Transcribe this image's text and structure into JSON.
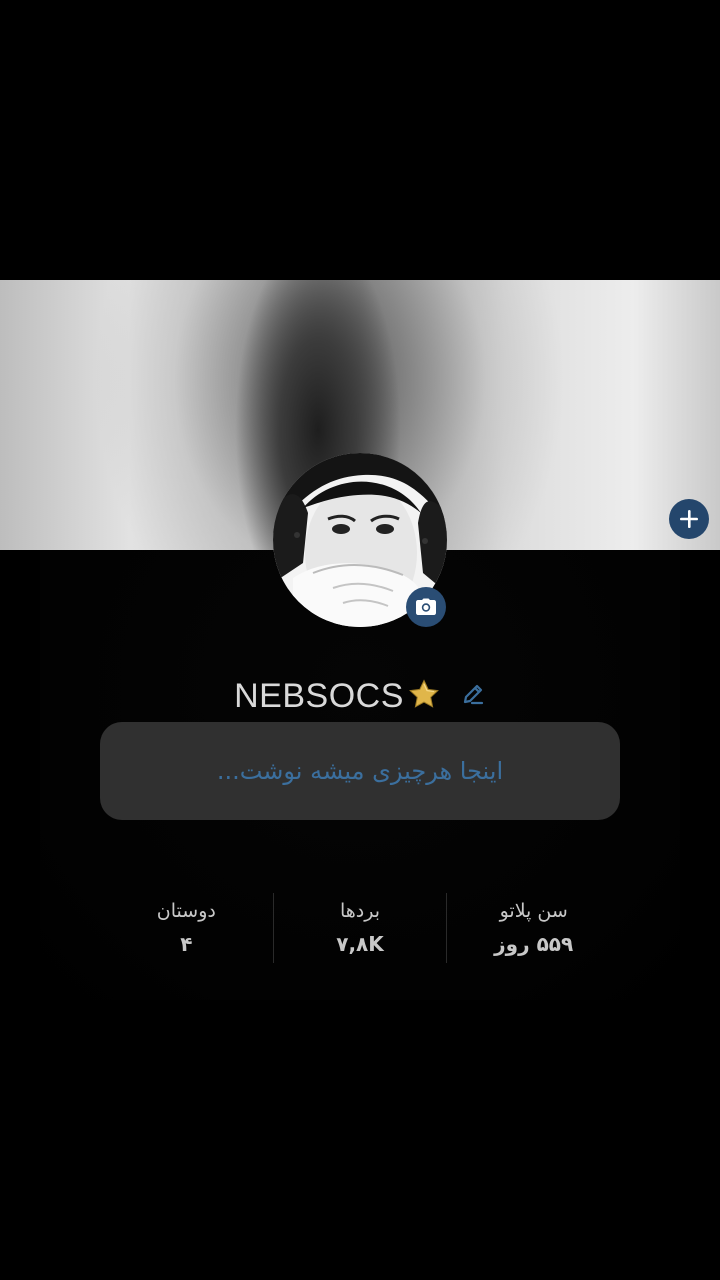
{
  "profile": {
    "username": "NEBSOCS",
    "bio_placeholder": "اینجا هرچیزی میشه نوشت..."
  },
  "stats": [
    {
      "label": "سن پلاتو",
      "value": "۵۵۹ روز"
    },
    {
      "label": "بردها",
      "value": "۷,۸K"
    },
    {
      "label": "دوستان",
      "value": "۴"
    }
  ],
  "icons": {
    "add": "plus-icon",
    "camera": "camera-icon",
    "star": "star-icon",
    "edit": "pencil-icon"
  },
  "colors": {
    "accent": "#2a4d74",
    "bio_text": "#3b6f9e",
    "star": "#e0b64a"
  }
}
